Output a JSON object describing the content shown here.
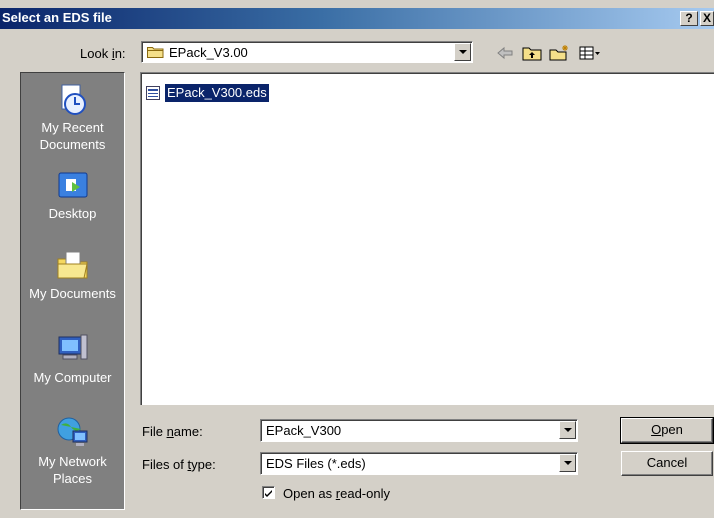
{
  "window": {
    "title": "Select an EDS file",
    "help_glyph": "?",
    "close_glyph": "X"
  },
  "lookin": {
    "label_pre": "Look ",
    "label_access": "i",
    "label_post": "n:",
    "value": "EPack_V3.00",
    "icon": "folder-icon"
  },
  "toolbar": {
    "icons": [
      "back-arrow-icon",
      "up-folder-icon",
      "new-folder-icon",
      "view-menu-icon"
    ]
  },
  "places": [
    {
      "line1": "My Recent",
      "line2": "Documents",
      "icon": "recent-documents-icon"
    },
    {
      "line1": "Desktop",
      "line2": "",
      "icon": "desktop-icon"
    },
    {
      "line1": "My Documents",
      "line2": "",
      "icon": "my-documents-icon"
    },
    {
      "line1": "My Computer",
      "line2": "",
      "icon": "my-computer-icon"
    },
    {
      "line1": "My Network",
      "line2": "Places",
      "icon": "network-places-icon"
    }
  ],
  "files": [
    {
      "name": "EPack_V300.eds",
      "selected": true,
      "icon": "eds-file-icon"
    }
  ],
  "filename": {
    "label_pre": "File ",
    "label_access": "n",
    "label_post": "ame:",
    "value": "EPack_V300"
  },
  "filetype": {
    "label_pre": "Files of ",
    "label_access": "t",
    "label_post": "ype:",
    "value": "EDS Files (*.eds)"
  },
  "readonly": {
    "checked": true,
    "label_pre": "Open as ",
    "label_access": "r",
    "label_post": "ead-only"
  },
  "buttons": {
    "open_access": "O",
    "open_rest": "pen",
    "cancel": "Cancel"
  },
  "colors": {
    "title_start": "#0a246a",
    "title_end": "#a6caf0",
    "face": "#d4d0c8",
    "places_bg": "#808080",
    "selection": "#0a246a"
  }
}
